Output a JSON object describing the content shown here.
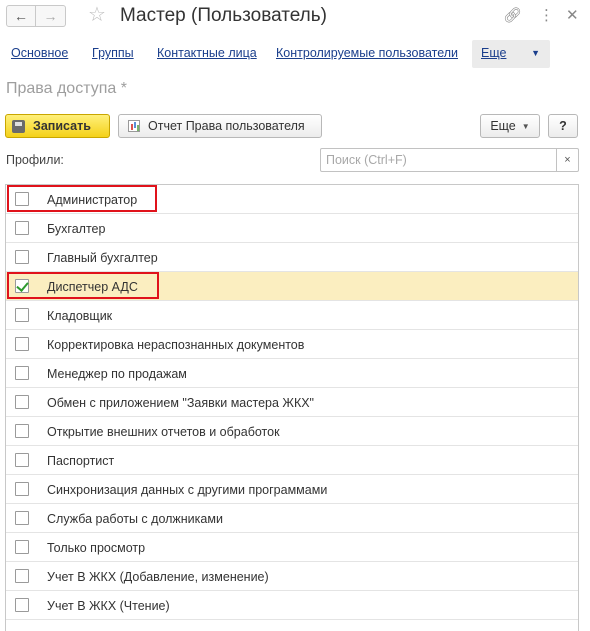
{
  "window": {
    "title": "Мастер (Пользователь)",
    "icons": [
      "back-arrow-icon",
      "forward-arrow-icon",
      "favorite-star-icon",
      "link-icon",
      "kebab-menu-icon",
      "close-icon"
    ]
  },
  "nav_links": [
    {
      "label": "Основное"
    },
    {
      "label": "Группы"
    },
    {
      "label": "Контактные лица"
    },
    {
      "label": "Контролируемые пользователи"
    }
  ],
  "nav_more": {
    "label": "Еще"
  },
  "section_title": "Права доступа *",
  "toolbar": {
    "save_label": "Записать",
    "report_label": "Отчет Права пользователя",
    "more_label": "Еще",
    "help_label": "?"
  },
  "profiles": {
    "label": "Профили:",
    "search_placeholder": "Поиск (Ctrl+F)",
    "clear_glyph": "×",
    "items": [
      {
        "label": "Администратор",
        "checked": false,
        "highlighted": true
      },
      {
        "label": "Бухгалтер",
        "checked": false
      },
      {
        "label": "Главный бухгалтер",
        "checked": false
      },
      {
        "label": "Диспетчер АДС",
        "checked": true,
        "selected": true,
        "highlighted": true
      },
      {
        "label": "Кладовщик",
        "checked": false
      },
      {
        "label": "Корректировка нераспознанных документов",
        "checked": false
      },
      {
        "label": "Менеджер по продажам",
        "checked": false
      },
      {
        "label": "Обмен с приложением \"Заявки мастера ЖКХ\"",
        "checked": false
      },
      {
        "label": "Открытие внешних отчетов и обработок",
        "checked": false
      },
      {
        "label": "Паспортист",
        "checked": false
      },
      {
        "label": "Синхронизация данных с другими программами",
        "checked": false
      },
      {
        "label": "Служба работы с должниками",
        "checked": false
      },
      {
        "label": "Только просмотр",
        "checked": false
      },
      {
        "label": "Учет В ЖКХ (Добавление, изменение)",
        "checked": false
      },
      {
        "label": "Учет В ЖКХ (Чтение)",
        "checked": false
      }
    ]
  },
  "colors": {
    "link": "#1a3e8c",
    "save_button": "#f4d11a",
    "selected_row": "#fbeec0",
    "highlight_border": "#e0121b",
    "check": "#2e9a2e"
  }
}
